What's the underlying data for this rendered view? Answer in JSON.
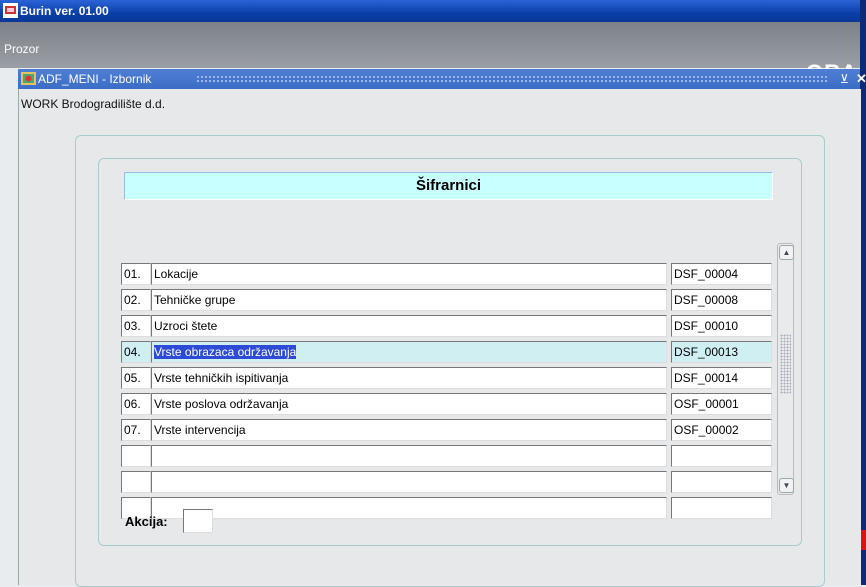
{
  "app": {
    "title": "Burin ver. 01.00"
  },
  "menubar": {
    "menu_label": "Prozor",
    "logo_text": "ORA"
  },
  "window": {
    "title": "ADF_MENI - Izbornik",
    "minimize_glyph": "⊻",
    "close_glyph": "✕",
    "company": "WORK Brodogradilište d.d."
  },
  "section": {
    "title": "Šifrarnici"
  },
  "rows": [
    {
      "num": "01.",
      "name": "Lokacije",
      "code": "DSF_00004"
    },
    {
      "num": "02.",
      "name": "Tehničke grupe",
      "code": "DSF_00008"
    },
    {
      "num": "03.",
      "name": "Uzroci štete",
      "code": "DSF_00010"
    },
    {
      "num": "04.",
      "name": "Vrste obrazaca održavanja",
      "code": "DSF_00013"
    },
    {
      "num": "05.",
      "name": "Vrste tehničkih ispitivanja",
      "code": "DSF_00014"
    },
    {
      "num": "06.",
      "name": "Vrste poslova održavanja",
      "code": "OSF_00001"
    },
    {
      "num": "07.",
      "name": "Vrste intervencija",
      "code": "OSF_00002"
    },
    {
      "num": "",
      "name": "",
      "code": ""
    },
    {
      "num": "",
      "name": "",
      "code": ""
    },
    {
      "num": "",
      "name": "",
      "code": ""
    }
  ],
  "selected_row": "04.",
  "action": {
    "label": "Akcija:",
    "value": ""
  },
  "scroll": {
    "up_glyph": "▲",
    "down_glyph": "▼"
  },
  "colors": {
    "section_header_bg": "#c8ffff",
    "selection": "#2d4bd7",
    "titlebar": "#0a3fa8"
  }
}
